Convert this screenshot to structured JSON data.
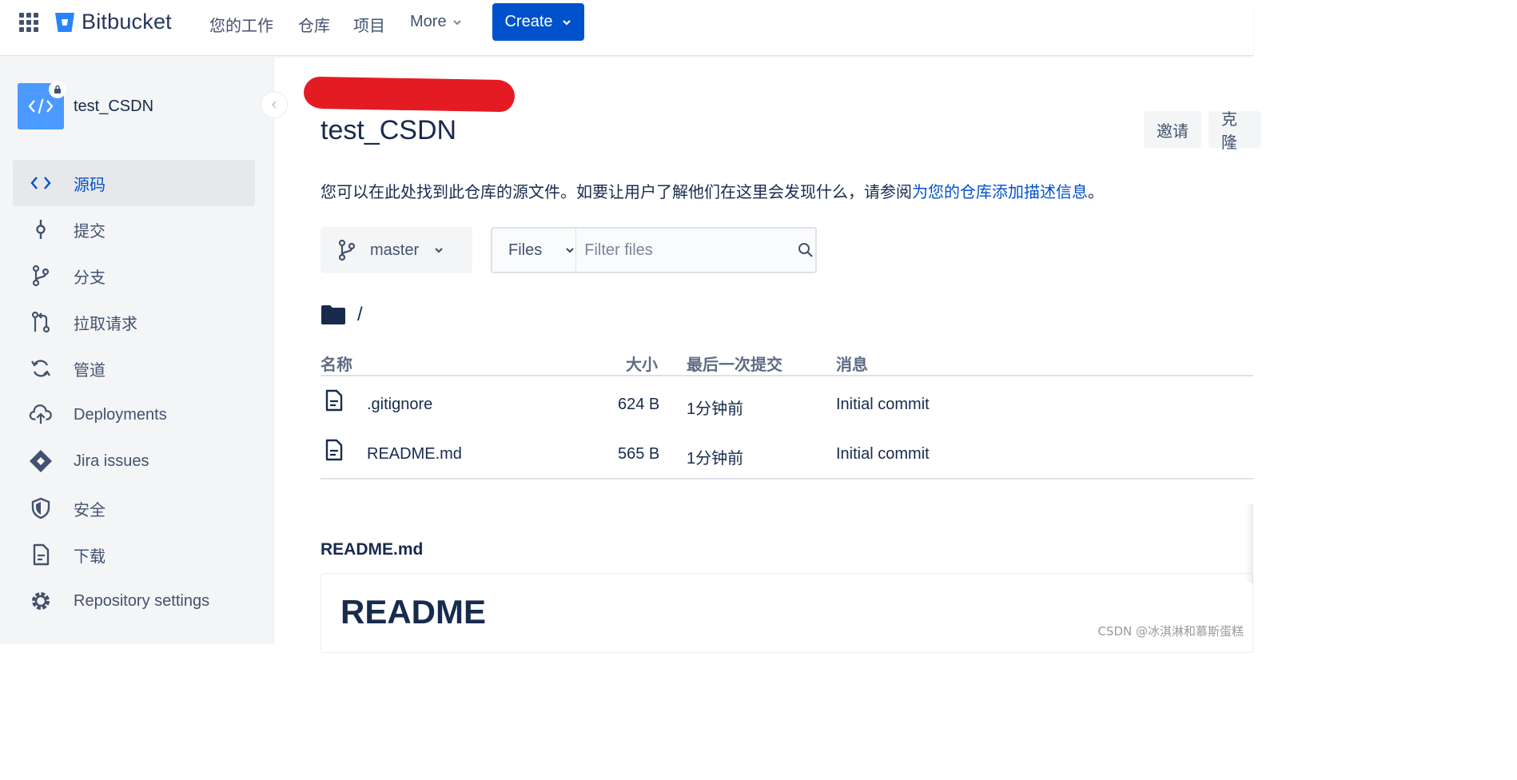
{
  "topnav": {
    "brand": "Bitbucket",
    "items": [
      "您的工作",
      "仓库",
      "项目"
    ],
    "more_label": "More",
    "create_label": "Create"
  },
  "sidebar": {
    "repo_name": "test_CSDN",
    "items": [
      {
        "label": "源码",
        "icon": "code-icon",
        "active": true
      },
      {
        "label": "提交",
        "icon": "commit-icon"
      },
      {
        "label": "分支",
        "icon": "branch-icon"
      },
      {
        "label": "拉取请求",
        "icon": "pull-request-icon"
      },
      {
        "label": "管道",
        "icon": "pipelines-icon"
      },
      {
        "label": "Deployments",
        "icon": "deployments-icon"
      },
      {
        "label": "Jira issues",
        "icon": "jira-icon"
      },
      {
        "label": "安全",
        "icon": "shield-icon"
      },
      {
        "label": "下载",
        "icon": "download-icon"
      },
      {
        "label": "Repository settings",
        "icon": "gear-icon"
      }
    ]
  },
  "main": {
    "title": "test_CSDN",
    "invite_label": "邀请",
    "clone_label": "克隆",
    "description_prefix": "您可以在此处找到此仓库的源文件。如要让用户了解他们在这里会发现什么，请参阅",
    "description_link": "为您的仓库添加描述信息",
    "description_suffix": "。",
    "branch": "master",
    "files_select": "Files",
    "filter_placeholder": "Filter files",
    "path": "/",
    "table": {
      "headers": {
        "name": "名称",
        "size": "大小",
        "last_commit": "最后一次提交",
        "message": "消息"
      },
      "rows": [
        {
          "name": ".gitignore",
          "size": "624 B",
          "time": "1分钟前",
          "message": "Initial commit"
        },
        {
          "name": "README.md",
          "size": "565 B",
          "time": "1分钟前",
          "message": "Initial commit"
        }
      ]
    },
    "readme_file": "README.md",
    "readme_heading": "README"
  },
  "watermark": "CSDN @冰淇淋和慕斯蛋糕",
  "colors": {
    "brand_blue": "#0052cc",
    "sidebar_bg": "#f4f5f7",
    "redaction": "#e51b23"
  }
}
